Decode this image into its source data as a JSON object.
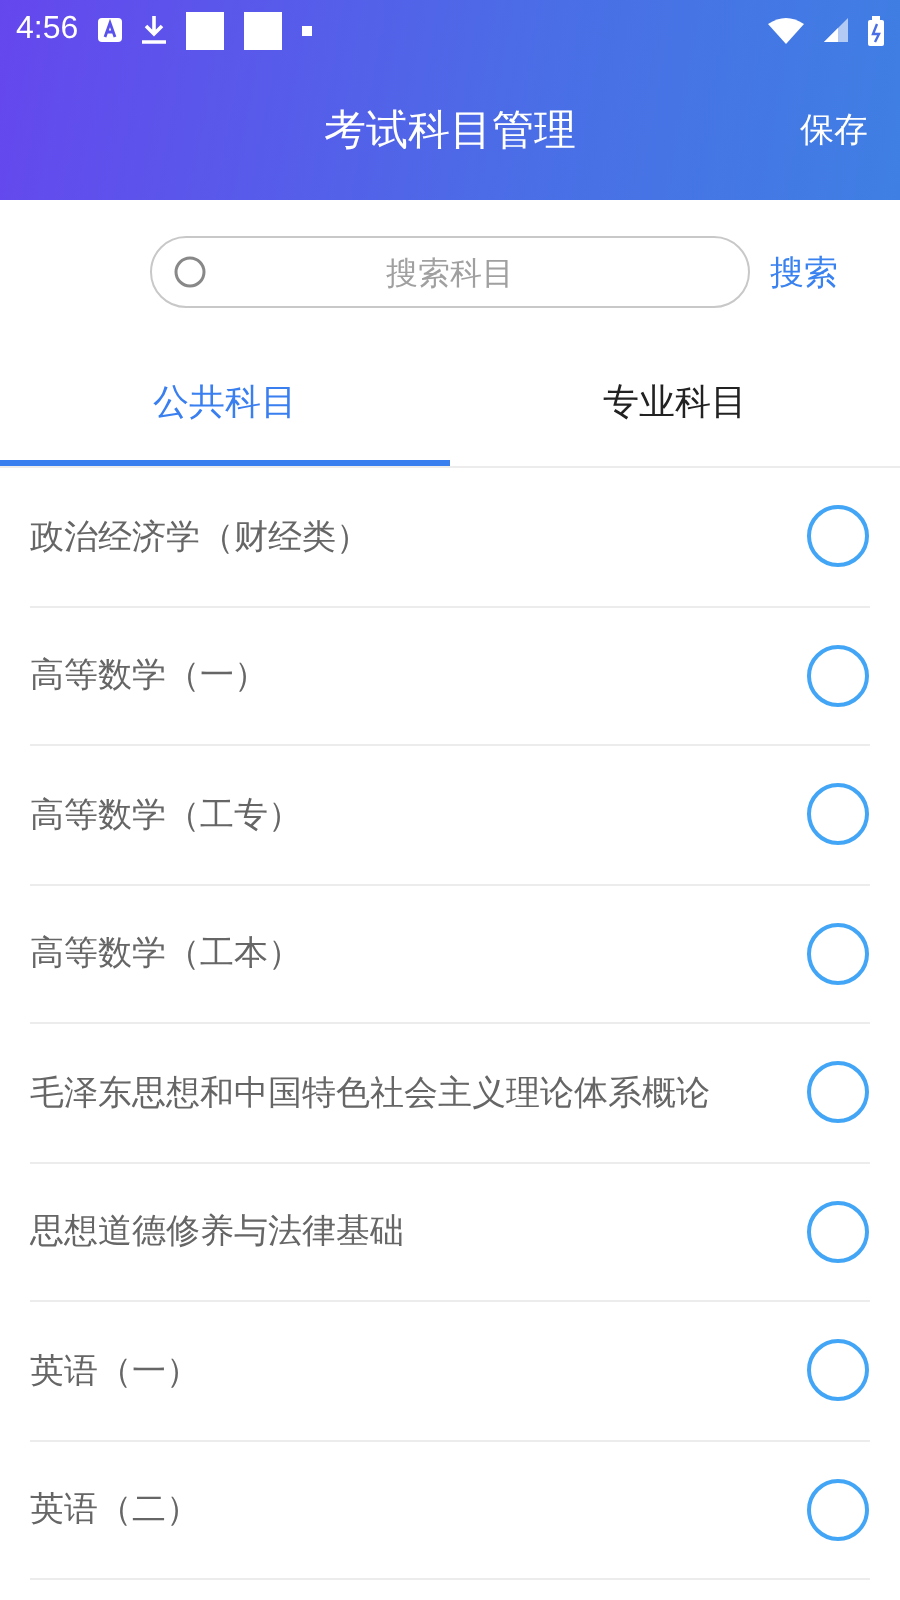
{
  "status_bar": {
    "time": "4:56"
  },
  "header": {
    "title": "考试科目管理",
    "action": "保存"
  },
  "search": {
    "placeholder": "搜索科目",
    "button": "搜索"
  },
  "tabs": [
    {
      "label": "公共科目",
      "selected": true
    },
    {
      "label": "专业科目",
      "selected": false
    }
  ],
  "subjects": [
    {
      "name": "政治经济学（财经类）",
      "selected": false
    },
    {
      "name": "高等数学（一）",
      "selected": false
    },
    {
      "name": "高等数学（工专）",
      "selected": false
    },
    {
      "name": "高等数学（工本）",
      "selected": false
    },
    {
      "name": "毛泽东思想和中国特色社会主义理论体系概论",
      "selected": false
    },
    {
      "name": "思想道德修养与法律基础",
      "selected": false
    },
    {
      "name": "英语（一）",
      "selected": false
    },
    {
      "name": "英语（二）",
      "selected": false
    }
  ]
}
